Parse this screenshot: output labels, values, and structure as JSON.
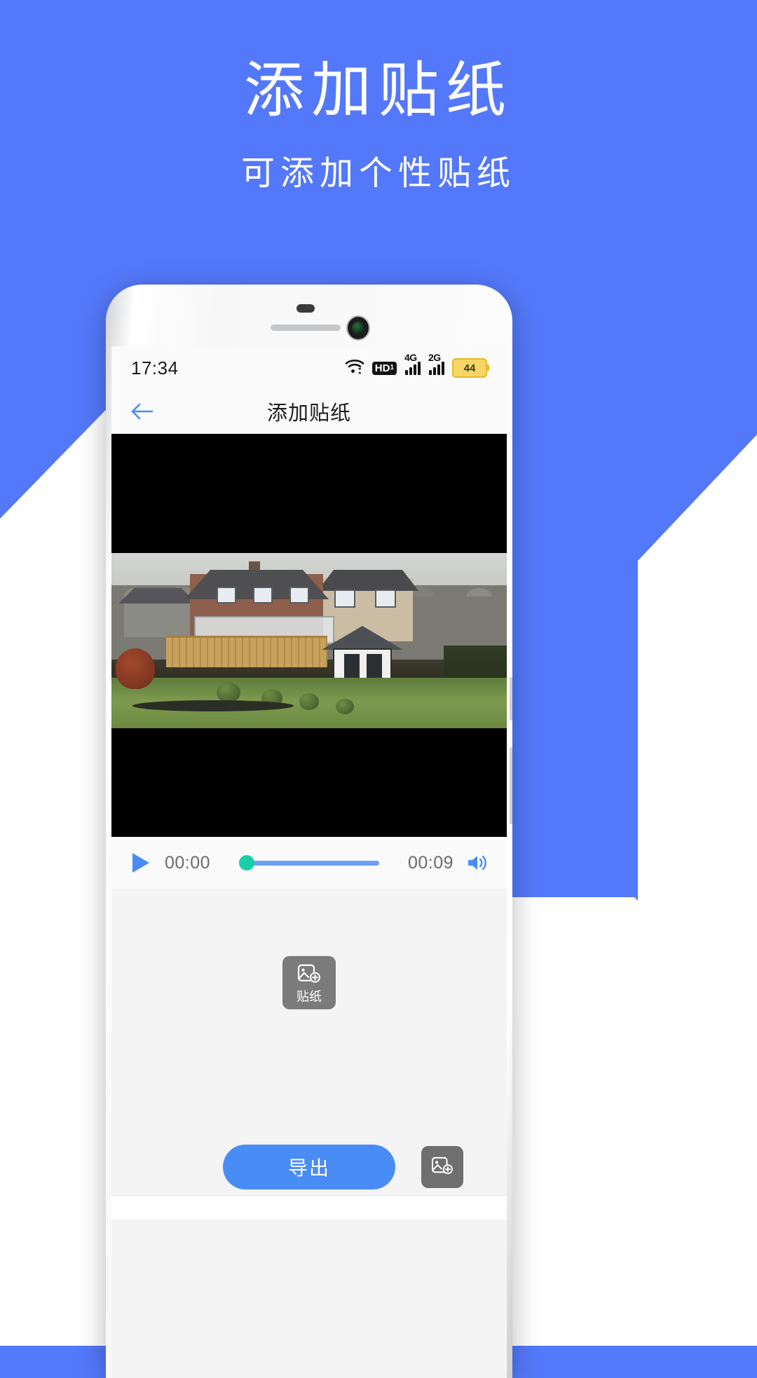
{
  "promo": {
    "title": "添加贴纸",
    "subtitle": "可添加个性贴纸",
    "background_color": "#5478fa",
    "text_color": "#ffffff"
  },
  "phone": {
    "status_bar": {
      "clock": "17:34",
      "icons": [
        "wifi-icon",
        "hd-voice-icon",
        "signal-4g-icon",
        "signal-2g-icon",
        "battery-icon"
      ],
      "network_1_label": "4G",
      "network_2_label": "2G",
      "hd_label": "HD",
      "hd_sub": "1",
      "battery_level": "44",
      "battery_color": "#f6d666"
    },
    "nav_bar": {
      "back_icon": "back-arrow-icon",
      "title": "添加贴纸",
      "accent_color": "#4a8cf5"
    },
    "player": {
      "play_icon": "play-icon",
      "current_time": "00:00",
      "total_time": "00:09",
      "volume_icon": "volume-icon",
      "progress_percent": 0,
      "track_color": "#6d9ff2",
      "thumb_color": "#17cfa9"
    },
    "editor": {
      "sticker_tool": {
        "icon": "sticker-add-icon",
        "label": "贴纸"
      }
    },
    "bottom_bar": {
      "export_label": "导出",
      "export_color": "#4a8cf5",
      "sticker_button_icon": "sticker-add-icon"
    }
  }
}
